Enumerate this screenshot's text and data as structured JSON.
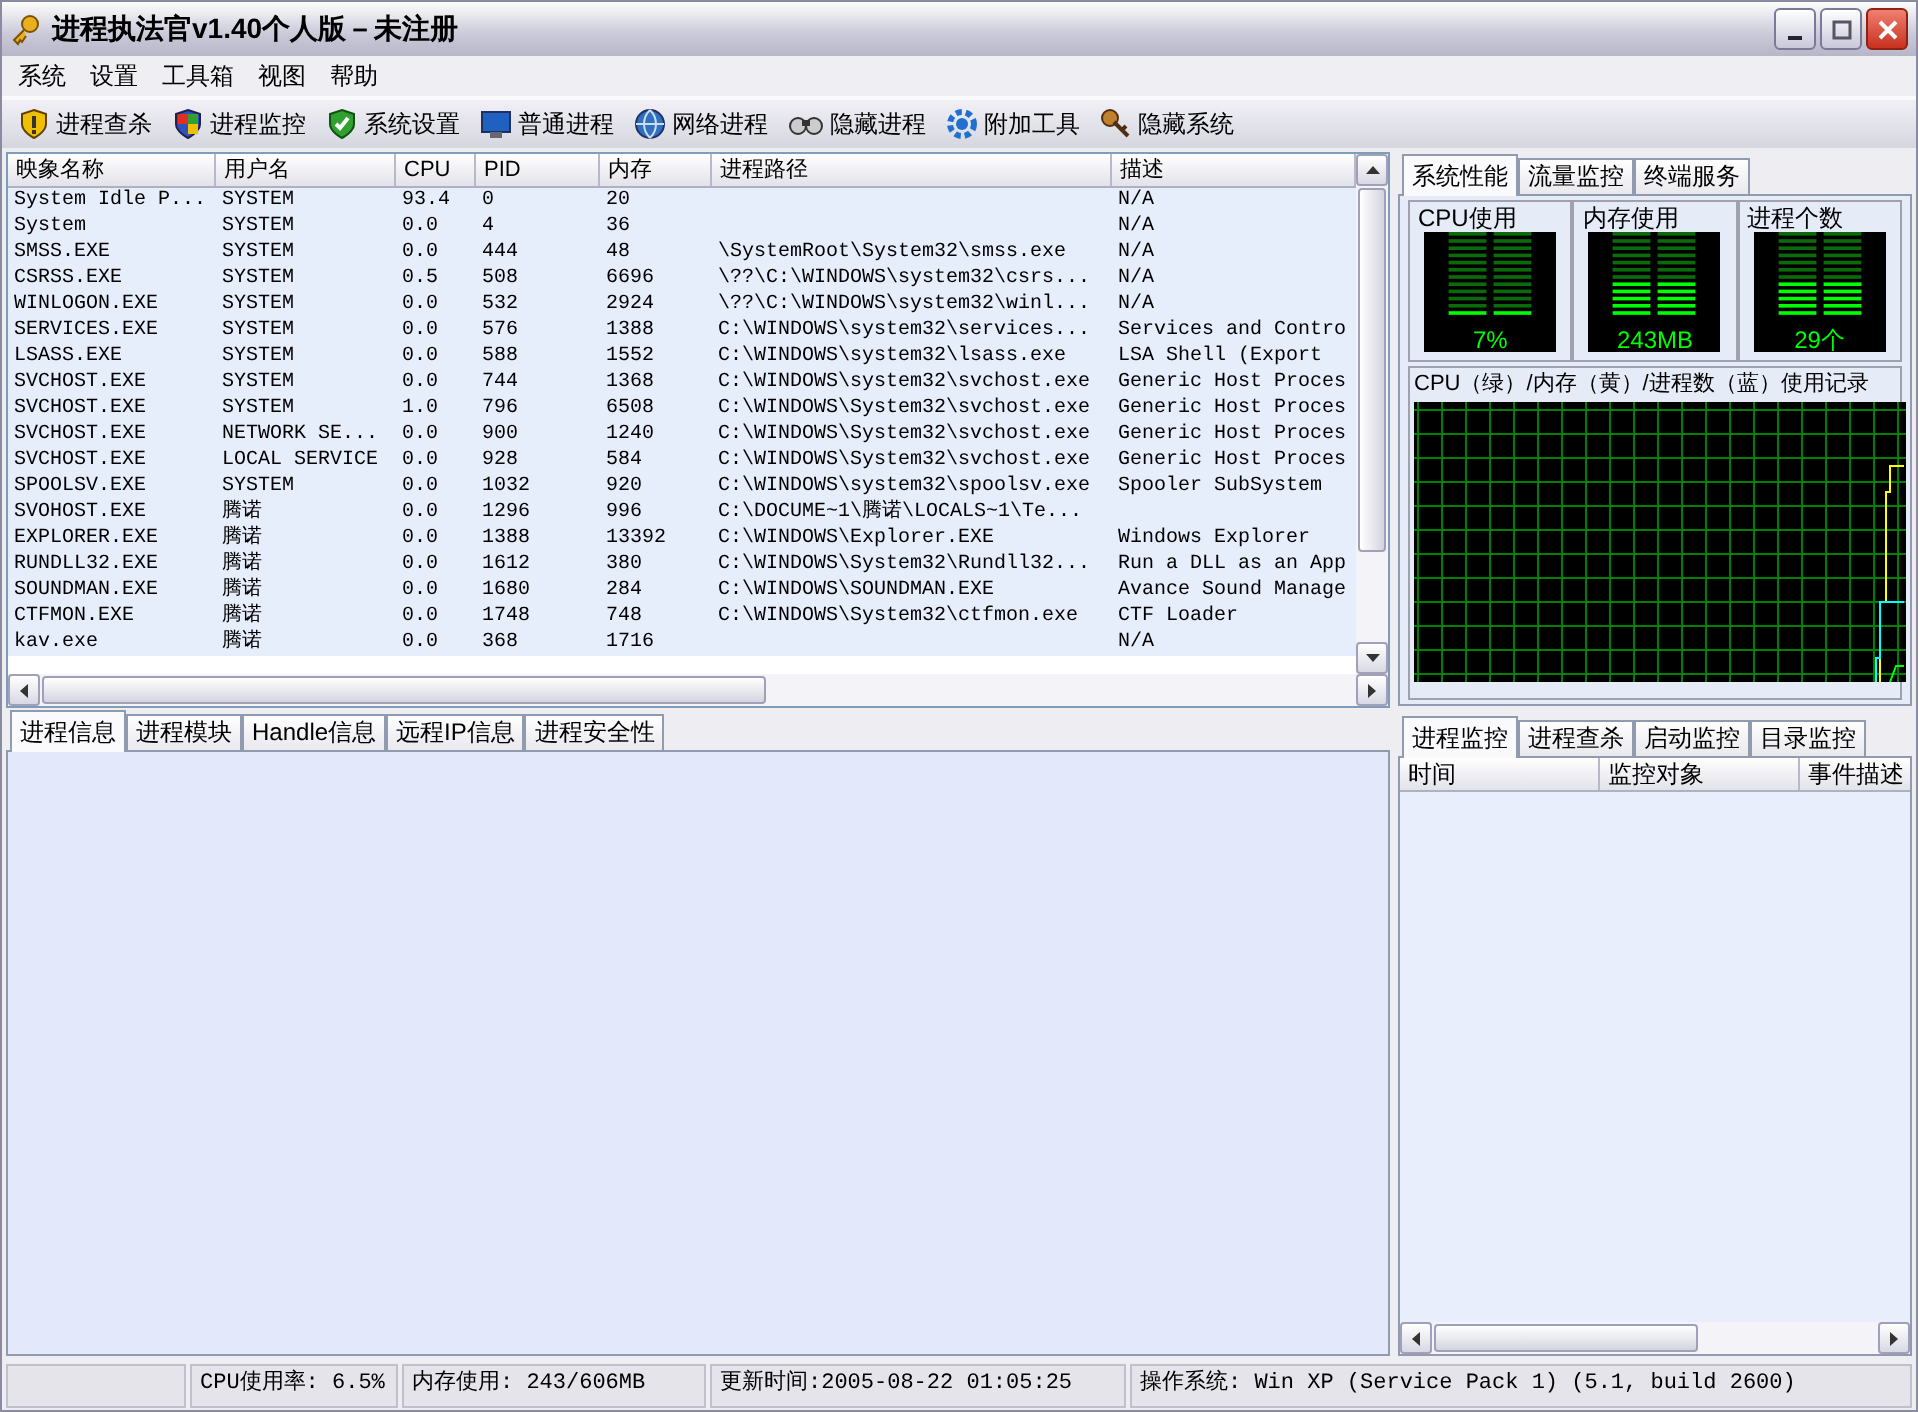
{
  "window": {
    "title": "进程执法官v1.40个人版－未注册"
  },
  "menu": [
    "系统",
    "设置",
    "工具箱",
    "视图",
    "帮助"
  ],
  "toolbar": [
    "进程查杀",
    "进程监控",
    "系统设置",
    "普通进程",
    "网络进程",
    "隐藏进程",
    "附加工具",
    "隐藏系统"
  ],
  "process_table": {
    "columns": [
      "映象名称",
      "用户名",
      "CPU",
      "PID",
      "内存",
      "进程路径",
      "描述"
    ],
    "rows": [
      [
        "System Idle P...",
        "SYSTEM",
        "93.4",
        "0",
        "20",
        "",
        "N/A"
      ],
      [
        "System",
        "SYSTEM",
        "0.0",
        "4",
        "36",
        "",
        "N/A"
      ],
      [
        "SMSS.EXE",
        "SYSTEM",
        "0.0",
        "444",
        "48",
        "\\SystemRoot\\System32\\smss.exe",
        "N/A"
      ],
      [
        "CSRSS.EXE",
        "SYSTEM",
        "0.5",
        "508",
        "6696",
        "\\??\\C:\\WINDOWS\\system32\\csrs...",
        "N/A"
      ],
      [
        "WINLOGON.EXE",
        "SYSTEM",
        "0.0",
        "532",
        "2924",
        "\\??\\C:\\WINDOWS\\system32\\winl...",
        "N/A"
      ],
      [
        "SERVICES.EXE",
        "SYSTEM",
        "0.0",
        "576",
        "1388",
        "C:\\WINDOWS\\system32\\services...",
        "Services and Contro"
      ],
      [
        "LSASS.EXE",
        "SYSTEM",
        "0.0",
        "588",
        "1552",
        "C:\\WINDOWS\\system32\\lsass.exe",
        "LSA Shell (Export"
      ],
      [
        "SVCHOST.EXE",
        "SYSTEM",
        "0.0",
        "744",
        "1368",
        "C:\\WINDOWS\\system32\\svchost.exe",
        "Generic Host Proces"
      ],
      [
        "SVCHOST.EXE",
        "SYSTEM",
        "1.0",
        "796",
        "6508",
        "C:\\WINDOWS\\System32\\svchost.exe",
        "Generic Host Proces"
      ],
      [
        "SVCHOST.EXE",
        "NETWORK SE...",
        "0.0",
        "900",
        "1240",
        "C:\\WINDOWS\\System32\\svchost.exe",
        "Generic Host Proces"
      ],
      [
        "SVCHOST.EXE",
        "LOCAL SERVICE",
        "0.0",
        "928",
        "584",
        "C:\\WINDOWS\\System32\\svchost.exe",
        "Generic Host Proces"
      ],
      [
        "SPOOLSV.EXE",
        "SYSTEM",
        "0.0",
        "1032",
        "920",
        "C:\\WINDOWS\\system32\\spoolsv.exe",
        "Spooler SubSystem"
      ],
      [
        "SVOHOST.EXE",
        "腾诺",
        "0.0",
        "1296",
        "996",
        "C:\\DOCUME~1\\腾诺\\LOCALS~1\\Te...",
        ""
      ],
      [
        "EXPLORER.EXE",
        "腾诺",
        "0.0",
        "1388",
        "13392",
        "C:\\WINDOWS\\Explorer.EXE",
        "Windows Explorer"
      ],
      [
        "RUNDLL32.EXE",
        "腾诺",
        "0.0",
        "1612",
        "380",
        "C:\\WINDOWS\\System32\\Rundll32...",
        "Run a DLL as an App"
      ],
      [
        "SOUNDMAN.EXE",
        "腾诺",
        "0.0",
        "1680",
        "284",
        "C:\\WINDOWS\\SOUNDMAN.EXE",
        "Avance Sound Manage"
      ],
      [
        "CTFMON.EXE",
        "腾诺",
        "0.0",
        "1748",
        "748",
        "C:\\WINDOWS\\System32\\ctfmon.exe",
        "CTF Loader"
      ],
      [
        "kav.exe",
        "腾诺",
        "0.0",
        "368",
        "1716",
        "",
        "N/A"
      ]
    ]
  },
  "detail_tabs": [
    {
      "label": "进程信息",
      "selected": true
    },
    {
      "label": "进程模块",
      "selected": false
    },
    {
      "label": "Handle信息",
      "selected": false
    },
    {
      "label": "远程IP信息",
      "selected": false
    },
    {
      "label": "进程安全性",
      "selected": false
    }
  ],
  "perf_tabs": [
    {
      "label": "系统性能",
      "selected": true
    },
    {
      "label": "流量监控",
      "selected": false
    },
    {
      "label": "终端服务",
      "selected": false
    }
  ],
  "gauges": [
    {
      "title": "CPU使用",
      "reading": "7%",
      "level": 0.07
    },
    {
      "title": "内存使用",
      "reading": "243MB",
      "level": 0.4
    },
    {
      "title": "进程个数",
      "reading": "29个",
      "level": 0.45
    }
  ],
  "history": {
    "title": "CPU（绿）/内存（黄）/进程数（蓝）使用记录"
  },
  "monitor_tabs": [
    {
      "label": "进程监控",
      "selected": true
    },
    {
      "label": "进程查杀",
      "selected": false
    },
    {
      "label": "启动监控",
      "selected": false
    },
    {
      "label": "目录监控",
      "selected": false
    }
  ],
  "monitor_table": {
    "columns": [
      "时间",
      "监控对象",
      "事件描述"
    ]
  },
  "status_bar": [
    "CPU使用率: 6.5%",
    "内存使用: 243/606MB",
    "更新时间:2005-08-22 01:05:25",
    "操作系统: Win XP (Service Pack 1) (5.1, build 2600)"
  ]
}
